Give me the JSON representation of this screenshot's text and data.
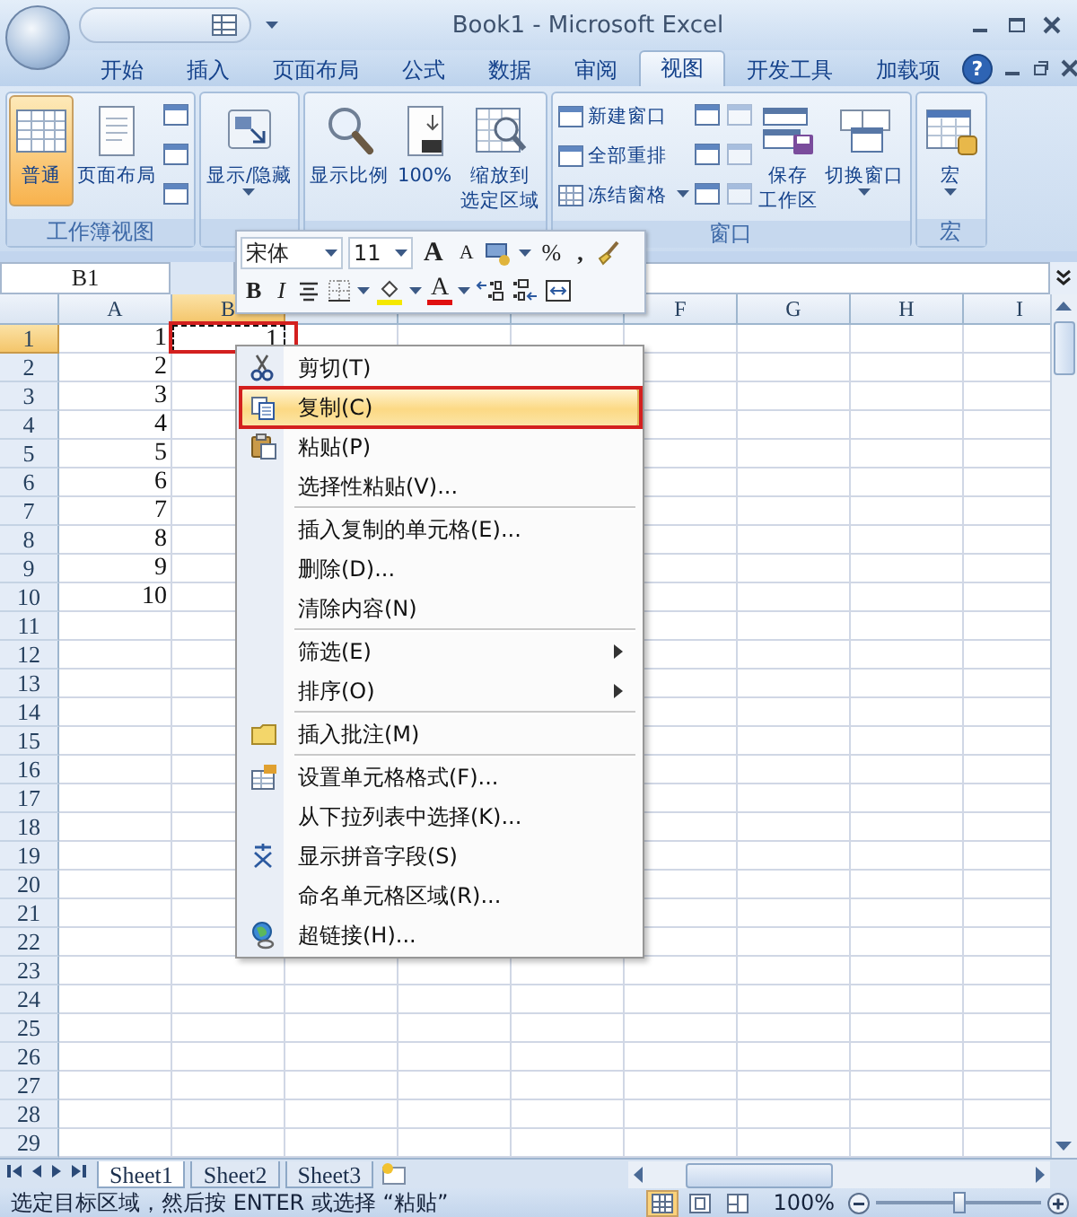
{
  "window": {
    "title": "Book1 - Microsoft Excel"
  },
  "ribbon_tabs": [
    {
      "label": "开始",
      "selected": false
    },
    {
      "label": "插入",
      "selected": false
    },
    {
      "label": "页面布局",
      "selected": false
    },
    {
      "label": "公式",
      "selected": false
    },
    {
      "label": "数据",
      "selected": false
    },
    {
      "label": "审阅",
      "selected": false
    },
    {
      "label": "视图",
      "selected": true
    },
    {
      "label": "开发工具",
      "selected": false
    },
    {
      "label": "加载项",
      "selected": false
    }
  ],
  "help": "?",
  "ribbon_groups": [
    {
      "label": "工作簿视图",
      "controls": [
        {
          "kind": "large",
          "label": "普通",
          "selected": true,
          "dropdown": false
        },
        {
          "kind": "large",
          "label": "页面布局",
          "selected": false,
          "dropdown": false
        },
        {
          "kind": "icons",
          "disabled": false
        }
      ]
    },
    {
      "controls": [
        {
          "kind": "large",
          "label": "显示/隐藏",
          "selected": false,
          "dropdown": true
        }
      ]
    },
    {
      "controls": [
        {
          "kind": "large",
          "label": "显示比例",
          "selected": false,
          "dropdown": false
        },
        {
          "kind": "large",
          "label": "100%",
          "selected": false,
          "dropdown": false
        },
        {
          "kind": "large",
          "lines": [
            "缩放到",
            "选定区域"
          ],
          "selected": false,
          "dropdown": false
        }
      ]
    },
    {
      "label": "窗口",
      "controls": [
        {
          "kind": "small",
          "items": [
            {
              "label": "新建窗口",
              "dropdown": false
            },
            {
              "label": "全部重排",
              "dropdown": false
            },
            {
              "label": "冻结窗格",
              "dropdown": true
            }
          ]
        },
        {
          "kind": "icons",
          "disabled": false
        },
        {
          "kind": "icons",
          "disabled": true
        },
        {
          "kind": "large",
          "lines": [
            "保存",
            "工作区"
          ],
          "selected": false,
          "dropdown": false
        },
        {
          "kind": "large",
          "label": "切换窗口",
          "selected": false,
          "dropdown": true
        }
      ]
    },
    {
      "label": "宏",
      "controls": [
        {
          "kind": "large",
          "label": "宏",
          "selected": false,
          "dropdown": true
        }
      ]
    }
  ],
  "mini_toolbar": {
    "font": "宋体",
    "size": "11",
    "grow": "A",
    "shrink": "A",
    "percent": "%",
    "comma": ",",
    "bold": "B",
    "italic": "I",
    "font_color": "A"
  },
  "name_box": "B1",
  "columns": [
    {
      "label": "A",
      "selected": false
    },
    {
      "label": "B",
      "selected": true
    },
    {
      "selected": false
    },
    {
      "selected": false
    },
    {
      "selected": false
    },
    {
      "label": "F",
      "selected": false
    },
    {
      "label": "G",
      "selected": false
    },
    {
      "label": "H",
      "selected": false
    },
    {
      "label": "I",
      "selected": false
    }
  ],
  "rows": [
    {
      "header": "1",
      "selected": true,
      "cells": [
        {
          "value": "1",
          "active": false,
          "copied": false,
          "annotated": false
        },
        {
          "value": "1",
          "active": true,
          "copied": true,
          "annotated": true
        }
      ]
    },
    {
      "header": "2",
      "selected": false,
      "cells": [
        {
          "value": "2",
          "active": false,
          "copied": false,
          "annotated": false
        }
      ]
    },
    {
      "header": "3",
      "selected": false,
      "cells": [
        {
          "value": "3",
          "active": false,
          "copied": false,
          "annotated": false
        }
      ]
    },
    {
      "header": "4",
      "selected": false,
      "cells": [
        {
          "value": "4",
          "active": false,
          "copied": false,
          "annotated": false
        }
      ]
    },
    {
      "header": "5",
      "selected": false,
      "cells": [
        {
          "value": "5",
          "active": false,
          "copied": false,
          "annotated": false
        }
      ]
    },
    {
      "header": "6",
      "selected": false,
      "cells": [
        {
          "value": "6",
          "active": false,
          "copied": false,
          "annotated": false
        }
      ]
    },
    {
      "header": "7",
      "selected": false,
      "cells": [
        {
          "value": "7",
          "active": false,
          "copied": false,
          "annotated": false
        }
      ]
    },
    {
      "header": "8",
      "selected": false,
      "cells": [
        {
          "value": "8",
          "active": false,
          "copied": false,
          "annotated": false
        }
      ]
    },
    {
      "header": "9",
      "selected": false,
      "cells": [
        {
          "value": "9",
          "active": false,
          "copied": false,
          "annotated": false
        }
      ]
    },
    {
      "header": "10",
      "selected": false,
      "cells": [
        {
          "value": "10",
          "active": false,
          "copied": false,
          "annotated": false
        }
      ]
    },
    {
      "header": "11",
      "selected": false
    },
    {
      "header": "12",
      "selected": false
    },
    {
      "header": "13",
      "selected": false
    },
    {
      "header": "14",
      "selected": false
    },
    {
      "header": "15",
      "selected": false
    },
    {
      "header": "16",
      "selected": false
    },
    {
      "header": "17",
      "selected": false
    },
    {
      "header": "18",
      "selected": false
    },
    {
      "header": "19",
      "selected": false
    },
    {
      "header": "20",
      "selected": false
    },
    {
      "header": "21",
      "selected": false
    },
    {
      "header": "22",
      "selected": false
    },
    {
      "header": "23",
      "selected": false
    },
    {
      "header": "24",
      "selected": false
    },
    {
      "header": "25",
      "selected": false
    },
    {
      "header": "26",
      "selected": false
    },
    {
      "header": "27",
      "selected": false
    },
    {
      "header": "28",
      "selected": false
    },
    {
      "header": "29",
      "selected": false
    }
  ],
  "context_menu": [
    {
      "kind": "cut",
      "label": "剪切(T)",
      "selected": false,
      "submenu": false,
      "annotated": false
    },
    {
      "kind": "copy",
      "label": "复制(C)",
      "selected": true,
      "submenu": false,
      "annotated": true
    },
    {
      "kind": "paste",
      "label": "粘贴(P)",
      "selected": false,
      "submenu": false,
      "annotated": false
    },
    {
      "kind": "plain",
      "label": "选择性粘贴(V)...",
      "selected": false,
      "submenu": false,
      "annotated": false
    },
    {
      "kind": "separator"
    },
    {
      "kind": "plain",
      "label": "插入复制的单元格(E)...",
      "selected": false,
      "submenu": false,
      "annotated": false
    },
    {
      "kind": "plain",
      "label": "删除(D)...",
      "selected": false,
      "submenu": false,
      "annotated": false
    },
    {
      "kind": "plain",
      "label": "清除内容(N)",
      "selected": false,
      "submenu": false,
      "annotated": false
    },
    {
      "kind": "separator"
    },
    {
      "kind": "plain",
      "label": "筛选(E)",
      "selected": false,
      "submenu": true,
      "annotated": false
    },
    {
      "kind": "plain",
      "label": "排序(O)",
      "selected": false,
      "submenu": true,
      "annotated": false
    },
    {
      "kind": "separator"
    },
    {
      "kind": "comment",
      "label": "插入批注(M)",
      "selected": false,
      "submenu": false,
      "annotated": false
    },
    {
      "kind": "separator"
    },
    {
      "kind": "format",
      "label": "设置单元格格式(F)...",
      "selected": false,
      "submenu": false,
      "annotated": false
    },
    {
      "kind": "plain",
      "label": "从下拉列表中选择(K)...",
      "selected": false,
      "submenu": false,
      "annotated": false
    },
    {
      "kind": "phonetic",
      "label": "显示拼音字段(S)",
      "selected": false,
      "submenu": false,
      "annotated": false
    },
    {
      "kind": "plain",
      "label": "命名单元格区域(R)...",
      "selected": false,
      "submenu": false,
      "annotated": false
    },
    {
      "kind": "link",
      "label": "超链接(H)...",
      "selected": false,
      "submenu": false,
      "annotated": false
    }
  ],
  "sheet_tabs": [
    {
      "label": "Sheet1",
      "selected": true
    },
    {
      "label": "Sheet2",
      "selected": false
    },
    {
      "label": "Sheet3",
      "selected": false
    }
  ],
  "status_bar": {
    "message": "选定目标区域，然后按 ENTER 或选择 “粘贴”",
    "views": [
      {
        "selected": true
      },
      {
        "selected": false
      },
      {
        "selected": false
      }
    ],
    "zoom": "100%",
    "zoom_slider": {
      "level": 0.5
    }
  }
}
